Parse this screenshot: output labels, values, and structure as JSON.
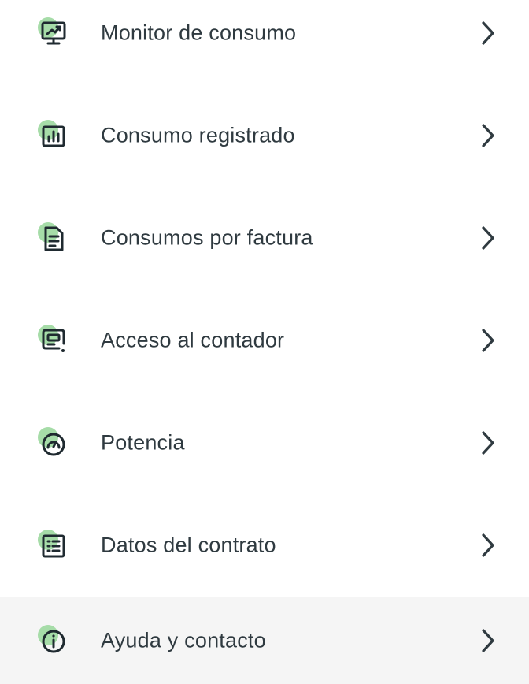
{
  "menu": {
    "items": [
      {
        "label": "Monitor de consumo",
        "icon": "monitor-chart-icon"
      },
      {
        "label": "Consumo registrado",
        "icon": "bar-chart-icon"
      },
      {
        "label": "Consumos por factura",
        "icon": "invoice-document-icon"
      },
      {
        "label": "Acceso al contador",
        "icon": "meter-display-icon"
      },
      {
        "label": "Potencia",
        "icon": "gauge-icon"
      },
      {
        "label": "Datos del contrato",
        "icon": "contract-list-icon"
      },
      {
        "label": "Ayuda y contacto",
        "icon": "info-icon"
      }
    ]
  },
  "colors": {
    "icon_stroke": "#1f2a30",
    "icon_accent_blob": "#a6dca8",
    "text": "#2f3a40",
    "chevron": "#2f3a40",
    "highlight_row_bg": "#f5f5f5"
  }
}
